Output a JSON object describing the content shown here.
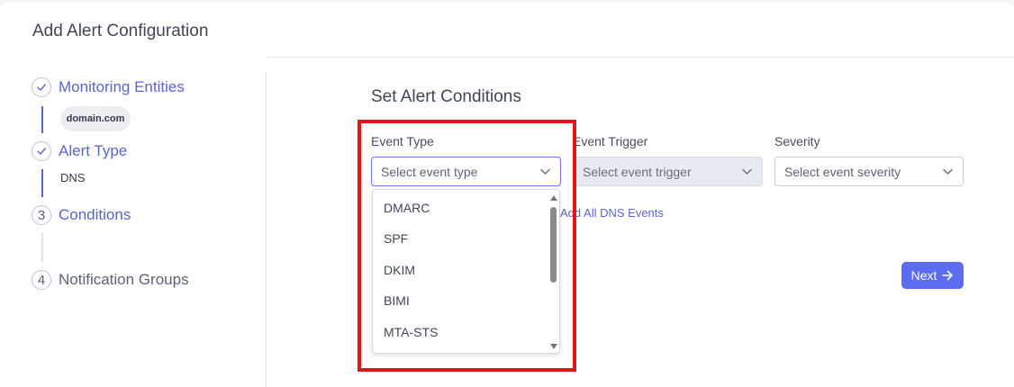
{
  "page": {
    "title": "Add Alert Configuration"
  },
  "stepper": {
    "steps": [
      {
        "label": "Monitoring Entities",
        "marker": "check-icon",
        "state": "complete",
        "detail": "domain.com"
      },
      {
        "label": "Alert Type",
        "marker": "check-icon",
        "state": "complete",
        "detail": "DNS"
      },
      {
        "label": "Conditions",
        "marker": "3",
        "state": "active"
      },
      {
        "label": "Notification Groups",
        "marker": "4",
        "state": "pending"
      }
    ]
  },
  "conditions": {
    "title": "Set Alert Conditions",
    "event_type": {
      "label": "Event Type",
      "placeholder": "Select event type"
    },
    "event_trigger": {
      "label": "Event Trigger",
      "placeholder": "Select event trigger"
    },
    "severity": {
      "label": "Severity",
      "placeholder": "Select event severity"
    },
    "dropdown_options": [
      "DMARC",
      "SPF",
      "DKIM",
      "BIMI",
      "MTA-STS"
    ],
    "add_all_link": "Add All DNS Events",
    "next_button": "Next"
  },
  "colors": {
    "accent": "#5b6cf0",
    "link": "#5a67c8",
    "highlight": "#e0161b"
  }
}
